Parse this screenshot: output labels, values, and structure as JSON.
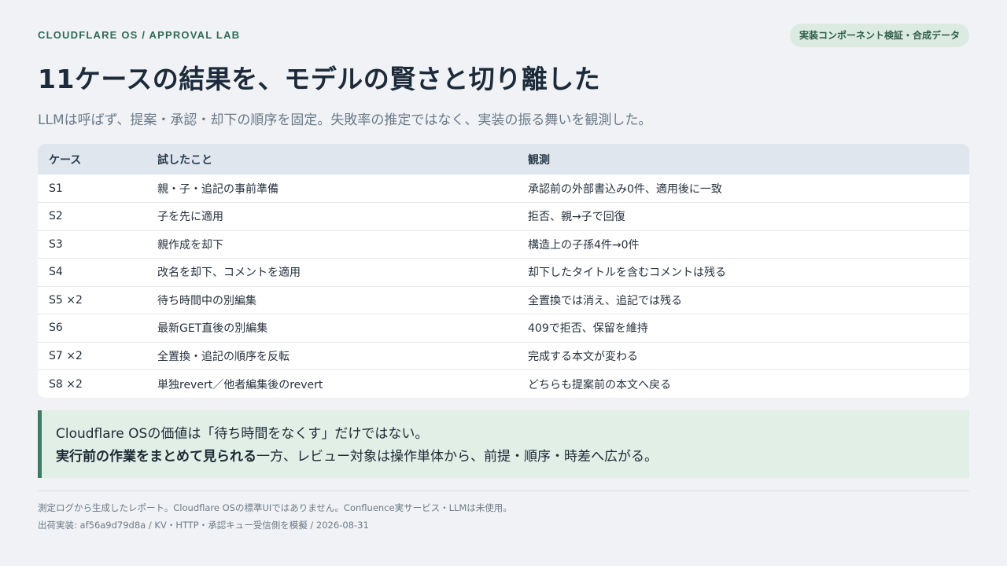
{
  "header": {
    "brand": "CLOUDFLARE OS / APPROVAL LAB",
    "badge": "実装コンポーネント検証・合成データ",
    "title": "11ケースの結果を、モデルの賢さと切り離した",
    "subtitle": "LLMは呼ばず、提案・承認・却下の順序を固定。失敗率の推定ではなく、実装の振る舞いを観測した。"
  },
  "table": {
    "columns": [
      "ケース",
      "試したこと",
      "観測"
    ],
    "rows": [
      [
        "S1",
        "親・子・追記の事前準備",
        "承認前の外部書込み0件、適用後に一致"
      ],
      [
        "S2",
        "子を先に適用",
        "拒否、親→子で回復"
      ],
      [
        "S3",
        "親作成を却下",
        "構造上の子孫4件→0件"
      ],
      [
        "S4",
        "改名を却下、コメントを適用",
        "却下したタイトルを含むコメントは残る"
      ],
      [
        "S5 ×2",
        "待ち時間中の別編集",
        "全置換では消え、追記では残る"
      ],
      [
        "S6",
        "最新GET直後の別編集",
        "409で拒否、保留を維持"
      ],
      [
        "S7 ×2",
        "全置換・追記の順序を反転",
        "完成する本文が変わる"
      ],
      [
        "S8 ×2",
        "単独revert／他者編集後のrevert",
        "どちらも提案前の本文へ戻る"
      ]
    ]
  },
  "callout": {
    "line1": "Cloudflare OSの価値は「待ち時間をなくす」だけではない。",
    "line2_strong": "実行前の作業をまとめて見られる",
    "line2_rest": "一方、レビュー対象は操作単体から、前提・順序・時差へ広がる。"
  },
  "footer": {
    "line1": "測定ログから生成したレポート。Cloudflare OSの標準UIではありません。Confluence実サービス・LLMは未使用。",
    "line2": "出荷実装: af56a9d79d8a / KV・HTTP・承認キュー受信側を模擬 / 2026-08-31"
  },
  "colors": {
    "accent": "#2f6b55",
    "callout_bg": "#e1efe6",
    "callout_border": "#3c7a62",
    "table_header_bg": "#dfe6ee",
    "page_bg": "#f0f2f5"
  }
}
